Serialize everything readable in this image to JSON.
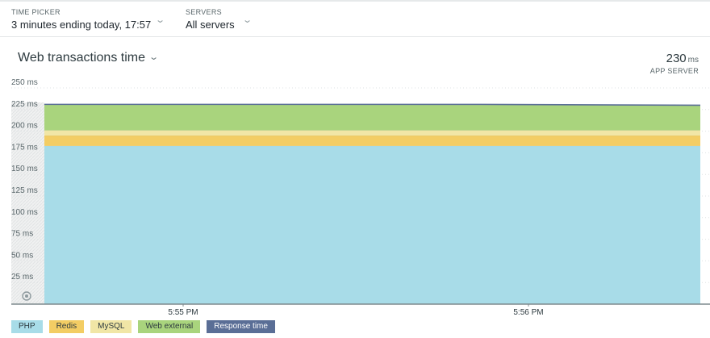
{
  "toolbar": {
    "time_picker": {
      "label": "TIME PICKER",
      "value": "3 minutes ending today, 17:57"
    },
    "servers": {
      "label": "SERVERS",
      "value": "All servers"
    }
  },
  "chart_header": {
    "title": "Web transactions time",
    "summary_value": "230",
    "summary_unit": "ms",
    "summary_label": "APP SERVER"
  },
  "chart_data": {
    "type": "area",
    "stacked": true,
    "title": "Web transactions time",
    "xlabel": "",
    "ylabel": "",
    "ylim": [
      0,
      250
    ],
    "yticks": [
      "250 ms",
      "225 ms",
      "200 ms",
      "175 ms",
      "150 ms",
      "125 ms",
      "100 ms",
      "75 ms",
      "50 ms",
      "25 ms"
    ],
    "ytick_values": [
      250,
      225,
      200,
      175,
      150,
      125,
      100,
      75,
      50,
      25
    ],
    "xticks": [
      "5:55 PM",
      "5:56 PM"
    ],
    "x": [
      "5:54:35 PM",
      "5:55 PM",
      "5:56 PM",
      "5:57 PM"
    ],
    "series": [
      {
        "name": "PHP",
        "color": "#a8dce8",
        "values": [
          183,
          183,
          183,
          183
        ]
      },
      {
        "name": "Redis",
        "color": "#f3cd64",
        "values": [
          12,
          12,
          12,
          12
        ]
      },
      {
        "name": "MySQL",
        "color": "#f1e6a6",
        "values": [
          6,
          6,
          6,
          6
        ]
      },
      {
        "name": "Web external",
        "color": "#a9d47d",
        "values": [
          30,
          30,
          30,
          29
        ]
      }
    ],
    "overlay": {
      "name": "Response time",
      "color": "#5a6e96",
      "values": [
        231,
        231,
        231,
        230
      ]
    },
    "grid": true,
    "legend_position": "bottom-left"
  },
  "legend": [
    {
      "label": "PHP",
      "color": "#a8dce8",
      "dark": false
    },
    {
      "label": "Redis",
      "color": "#f3cd64",
      "dark": false
    },
    {
      "label": "MySQL",
      "color": "#f1e6a6",
      "dark": false
    },
    {
      "label": "Web external",
      "color": "#a9d47d",
      "dark": false
    },
    {
      "label": "Response time",
      "color": "#5a6e96",
      "dark": true
    }
  ],
  "icons": {
    "chevron": "chevron-down-icon",
    "reset": "reset-zoom-icon"
  }
}
